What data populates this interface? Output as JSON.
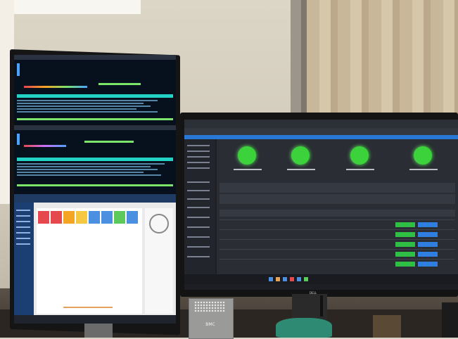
{
  "scene": {
    "description_colors": {
      "wall": "#dcd6c6",
      "accent_green": "#3bd23b",
      "accent_blue": "#2a78d6",
      "terminal_cyan": "#22d3c5"
    },
    "left_monitor": {
      "orientation": "portrait",
      "top_panels": [
        "terminal-htop",
        "terminal-htop"
      ],
      "bottom_panel": "browser-dashboard"
    },
    "right_monitor": {
      "orientation": "landscape",
      "status_nodes": 4,
      "table_rows": 5,
      "brand": "DELL"
    },
    "desk_items": {
      "box_logo": "BMC"
    }
  }
}
